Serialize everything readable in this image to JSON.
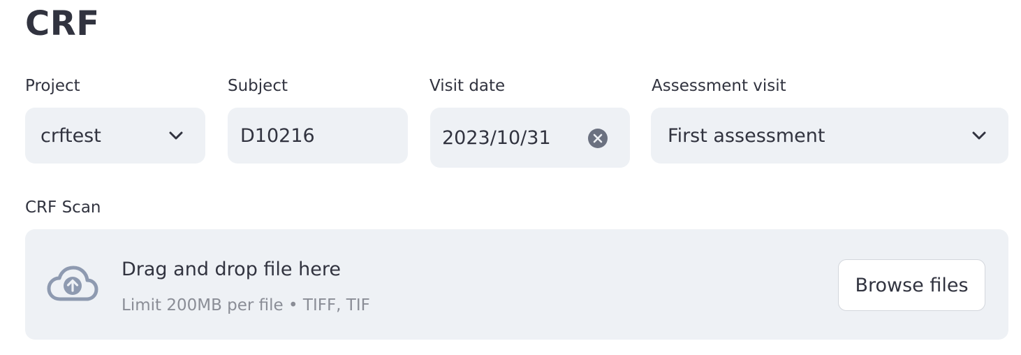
{
  "page": {
    "title": "CRF"
  },
  "form": {
    "project": {
      "label": "Project",
      "value": "crftest"
    },
    "subject": {
      "label": "Subject",
      "value": "D10216"
    },
    "visit_date": {
      "label": "Visit date",
      "value": "2023/10/31"
    },
    "assessment_visit": {
      "label": "Assessment visit",
      "value": "First assessment"
    }
  },
  "upload": {
    "label": "CRF Scan",
    "drop_text": "Drag and drop file here",
    "limit_text": "Limit 200MB per file • TIFF, TIF",
    "browse_label": "Browse files"
  },
  "icons": {
    "dropdown": "chevron-down-icon",
    "clear": "clear-icon",
    "upload": "cloud-upload-icon"
  },
  "colors": {
    "field_background": "#eef1f5",
    "text": "#31333f",
    "muted_text": "#8a8d96",
    "icon": "#8e9ab0"
  }
}
